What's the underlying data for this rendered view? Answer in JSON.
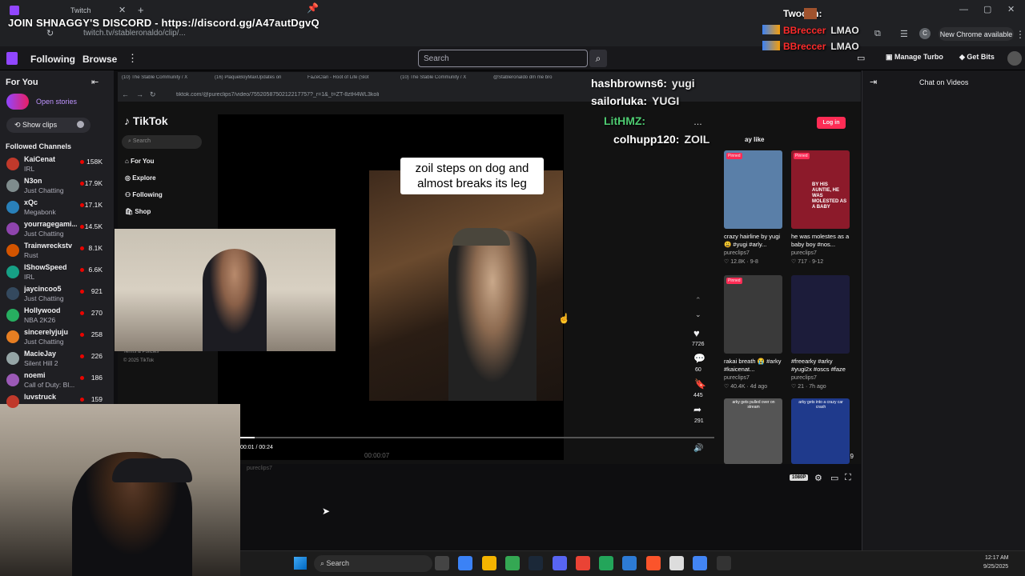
{
  "overlay": {
    "discord_banner": "JOIN SHNAGGY'S DISCORD - https://discord.gg/A47autDgvQ",
    "tab_title": "Twitch",
    "url": "twitch.tv/stableronaldo/clip/...",
    "new_chrome": "New Chrome available"
  },
  "nav": {
    "following": "Following",
    "browse": "Browse",
    "search_placeholder": "Search",
    "manage_turbo": "Manage Turbo",
    "get_bits": "Get Bits"
  },
  "sidebar": {
    "for_you": "For You",
    "open_stories": "Open stories",
    "show_clips": "Show clips",
    "followed_channels": "Followed Channels",
    "channels": [
      {
        "name": "KaiCenat",
        "game": "IRL",
        "viewers": "158K",
        "color": "#c0392b"
      },
      {
        "name": "N3on",
        "game": "Just Chatting",
        "viewers": "17.9K",
        "color": "#7f8c8d"
      },
      {
        "name": "xQc",
        "game": "Megabonk",
        "viewers": "17.1K",
        "color": "#2980b9"
      },
      {
        "name": "yourragegami...",
        "game": "Just Chatting",
        "viewers": "14.5K",
        "color": "#8e44ad"
      },
      {
        "name": "Trainwreckstv",
        "game": "Rust",
        "viewers": "8.1K",
        "color": "#d35400"
      },
      {
        "name": "IShowSpeed",
        "game": "IRL",
        "viewers": "6.6K",
        "color": "#16a085"
      },
      {
        "name": "jaycincoo5",
        "game": "Just Chatting",
        "viewers": "921",
        "color": "#34495e"
      },
      {
        "name": "Hollywood",
        "game": "NBA 2K26",
        "viewers": "270",
        "color": "#27ae60"
      },
      {
        "name": "sincerelyjuju",
        "game": "Just Chatting",
        "viewers": "258",
        "color": "#e67e22"
      },
      {
        "name": "MacieJay",
        "game": "Silent Hill 2",
        "viewers": "226",
        "color": "#95a5a6"
      },
      {
        "name": "noemi",
        "game": "Call of Duty: Bl...",
        "viewers": "186",
        "color": "#9b59b6"
      },
      {
        "name": "luvstruck",
        "game": "",
        "viewers": "159",
        "color": "#c0392b"
      }
    ]
  },
  "inner_browser": {
    "tabs": [
      "(10) The Stable Community / X",
      "(16) PlaqueBoyMaxUpdates on",
      "FaZeClan - Root of Life (Slot",
      "(10) The Stable Community / X",
      "@Stableronaldo dm me bro"
    ],
    "url": "tiktok.com/@pureclips7/video/7552058750212217757?_r=1&_t=ZT-8ztH4WL3koli"
  },
  "tiktok": {
    "logo": "TikTok",
    "search": "Search",
    "menu": [
      "For You",
      "Explore",
      "Following",
      "Shop"
    ],
    "terms": "Terms & Policies",
    "copyright": "© 2025 TikTok",
    "caption": "zoil steps on dog and almost breaks its leg",
    "likes": "7726",
    "comments": "60",
    "saves": "445",
    "shares": "291",
    "login": "Log in",
    "you_may_like": "ay like",
    "time": "00:01 / 00:24",
    "video_time2": "00:00:07",
    "username": "pureclips7",
    "quality": "1080P",
    "page_count": "19",
    "pinned_label": "Pinned",
    "related": [
      {
        "title": "crazy hairline by yugi 😩 #yugi #arly...",
        "author": "pureclips7",
        "stats": "♡ 12.8K · 9-8",
        "color": "#5a7fa8"
      },
      {
        "title": "he was molestes as a baby boy #nos...",
        "author": "pureclips7",
        "stats": "♡ 717 · 9-12",
        "color": "#8c1a2a",
        "overlay": "BY HIS AUNTIE, HE WAS MOLESTED AS A BABY"
      },
      {
        "title": "rakai breath 😭 #arky #kaicenat...",
        "author": "pureclips7",
        "stats": "♡ 40.4K · 4d ago",
        "color": "#3a3a3a"
      },
      {
        "title": "#freearky #arky #yugi2x #oscs #faze",
        "author": "pureclips7",
        "stats": "♡ 21 · 7h ago",
        "color": "#1c1c3a"
      },
      {
        "title": "arky gets pulled over on stream",
        "author": "",
        "stats": "",
        "color": "#555"
      },
      {
        "title": "arky gets into a crazy car crash",
        "author": "",
        "stats": "",
        "color": "#1f3a8c"
      }
    ]
  },
  "chat": {
    "header": "Chat on Videos",
    "overlay_lines": [
      {
        "user": "Twocon:",
        "msg": "",
        "color": "#ffffff"
      },
      {
        "user": "BBreccer",
        "msg": "LMAO",
        "color": "#ff2b2b"
      },
      {
        "user": "BBreccer",
        "msg": "LMAO",
        "color": "#ff2b2b"
      },
      {
        "user": "hashbrowns6:",
        "msg": "yugi",
        "color": "#ffffff"
      },
      {
        "user": "sailorluka:",
        "msg": "YUGI",
        "color": "#ffffff"
      },
      {
        "user": "LitHMZ:",
        "msg": "",
        "color": "#4ecb71"
      },
      {
        "user": "colhupp120:",
        "msg": "ZOIL",
        "color": "#ffffff"
      }
    ]
  },
  "taskbar": {
    "search": "Search",
    "time": "12:17 AM",
    "date": "9/25/2025"
  }
}
